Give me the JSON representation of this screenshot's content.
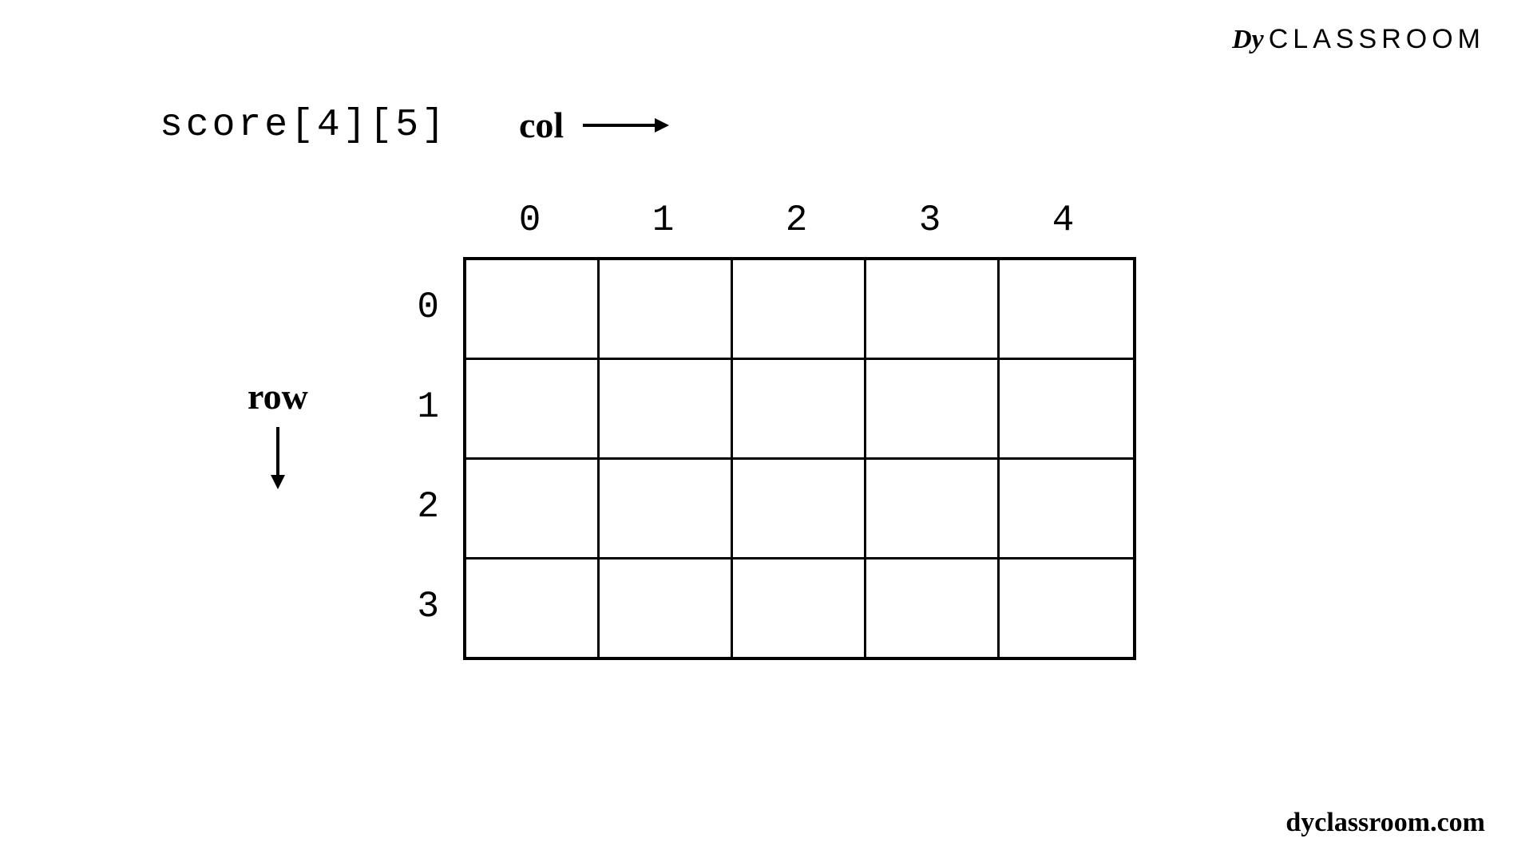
{
  "logo": {
    "icon": "Dy",
    "text": "CLASSROOM"
  },
  "declaration": "score[4][5]",
  "labels": {
    "col": "col",
    "row": "row"
  },
  "grid": {
    "rows": 4,
    "cols": 5,
    "colHeaders": [
      "0",
      "1",
      "2",
      "3",
      "4"
    ],
    "rowHeaders": [
      "0",
      "1",
      "2",
      "3"
    ]
  },
  "footer": "dyclassroom.com"
}
